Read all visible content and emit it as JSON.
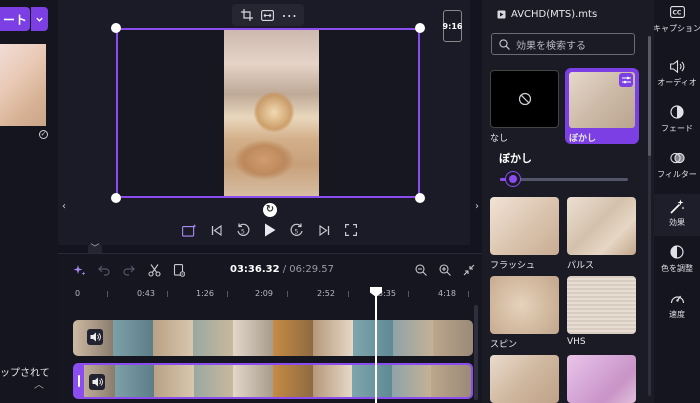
{
  "left_panel": {
    "export_label": "ート",
    "backup_text": "ップされて"
  },
  "preview": {
    "aspect_ratio": "9:16"
  },
  "timeline": {
    "current_time": "03:36.32",
    "separator": " / ",
    "total_time": "06:29.57",
    "ruler_ticks": [
      "0",
      "0:43",
      "1:26",
      "2:09",
      "2:52",
      "3:35",
      "4:18"
    ]
  },
  "effects_panel": {
    "file_name": "AVCHD(MTS).mts",
    "search_placeholder": "効果を検索する",
    "selected_effect_heading": "ぼかし",
    "blur_level": 0.1,
    "effects": [
      {
        "label": "なし"
      },
      {
        "label": "ぼかし",
        "selected": true
      },
      {
        "label": "フラッシュ"
      },
      {
        "label": "パルス"
      },
      {
        "label": "スピン"
      },
      {
        "label": "VHS"
      }
    ]
  },
  "right_nav": {
    "items": [
      {
        "label": "キャプション",
        "icon": "cc-icon"
      },
      {
        "label": "オーディオ",
        "icon": "speaker-icon"
      },
      {
        "label": "フェード",
        "icon": "fade-icon"
      },
      {
        "label": "フィルター",
        "icon": "filter-icon"
      },
      {
        "label": "効果",
        "icon": "magic-wand-icon",
        "active": true
      },
      {
        "label": "色を調整",
        "icon": "color-adjust-icon"
      },
      {
        "label": "速度",
        "icon": "speedometer-icon"
      }
    ]
  },
  "colors": {
    "accent": "#8b4df0",
    "button": "#7b3fe4",
    "background": "#141420"
  }
}
